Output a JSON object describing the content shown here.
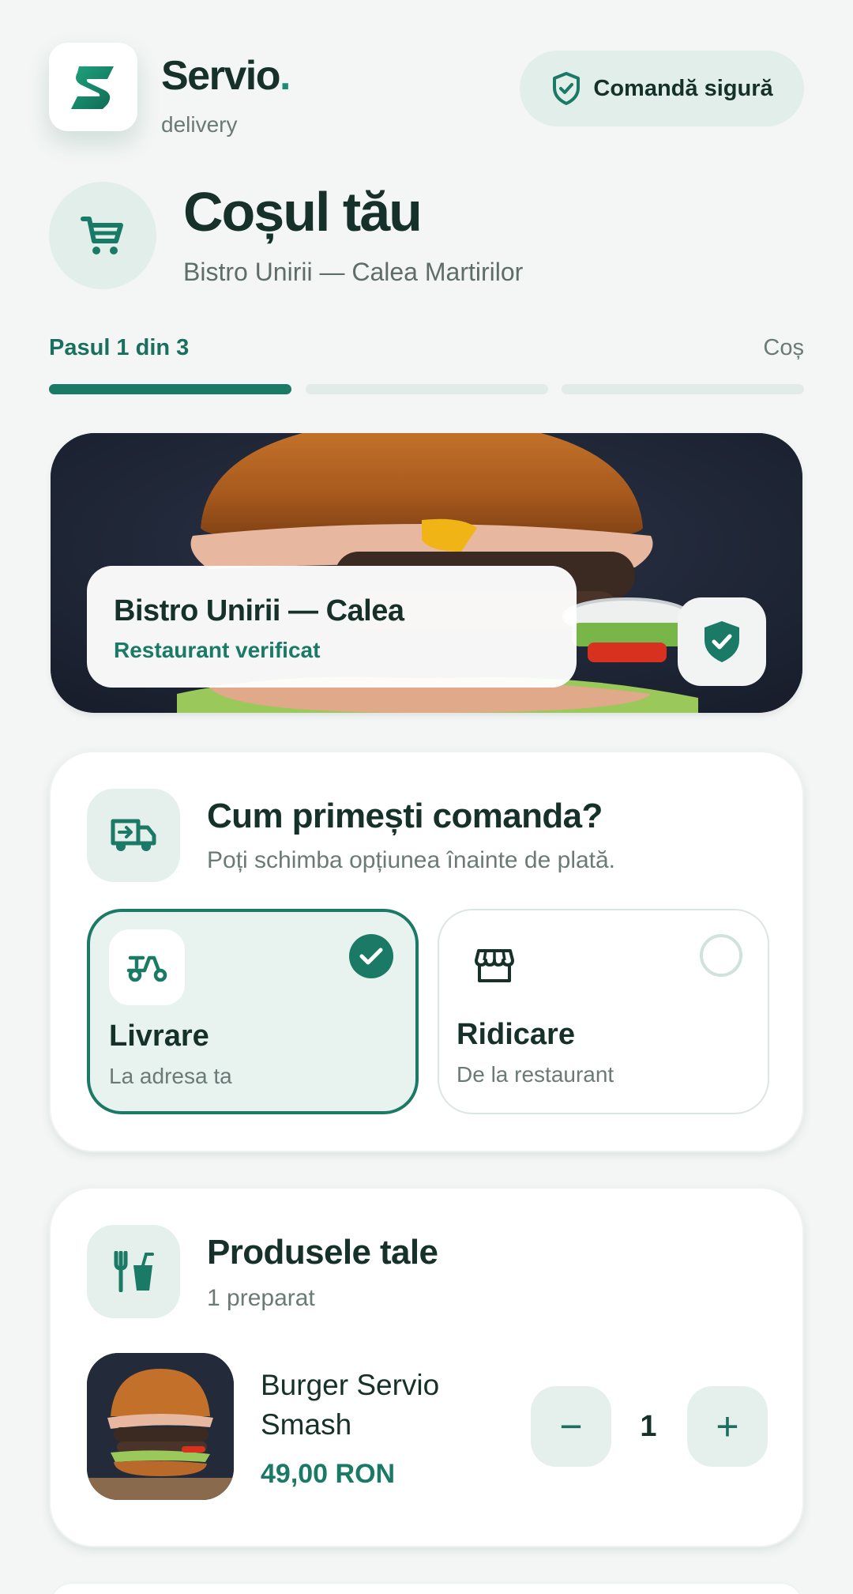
{
  "header": {
    "brand_name": "Servio",
    "brand_dot": ".",
    "brand_sub": "delivery",
    "secure_label": "Comandă sigură"
  },
  "title": {
    "heading": "Coșul tău",
    "subtitle": "Bistro Unirii — Calea Martirilor"
  },
  "progress": {
    "step_label": "Pasul 1 din 3",
    "current_name": "Coș",
    "step": 1,
    "total": 3
  },
  "hero": {
    "restaurant": "Bistro Unirii — Calea",
    "verified": "Restaurant verificat"
  },
  "delivery": {
    "title": "Cum primești comanda?",
    "subtitle": "Poți schimba opțiunea înainte de plată.",
    "options": [
      {
        "label": "Livrare",
        "sub": "La adresa ta",
        "selected": true
      },
      {
        "label": "Ridicare",
        "sub": "De la restaurant",
        "selected": false
      }
    ]
  },
  "products": {
    "title": "Produsele tale",
    "subtitle": "1 preparat",
    "items": [
      {
        "name": "Burger Servio Smash",
        "price": "49,00 RON",
        "qty": "1"
      }
    ],
    "minus": "−",
    "plus": "+"
  },
  "colors": {
    "accent": "#1a7a65",
    "accent_light": "#e2eeea",
    "text": "#163129",
    "background": "#f3f6f5"
  }
}
